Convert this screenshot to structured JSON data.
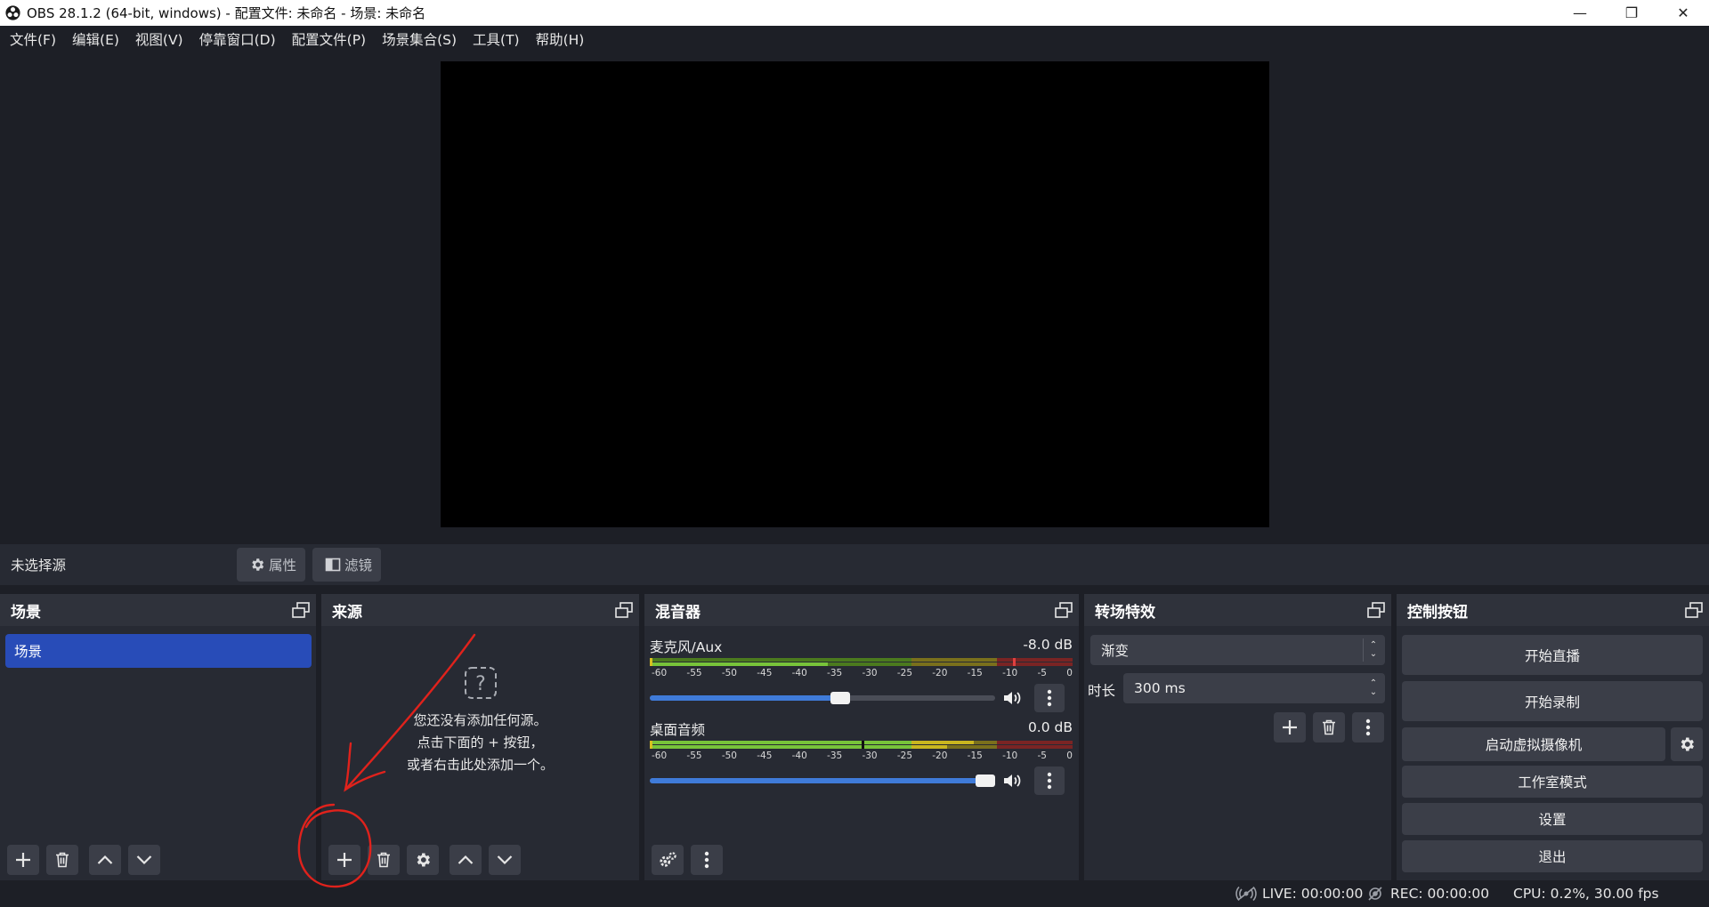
{
  "window": {
    "title": "OBS 28.1.2 (64-bit, windows) - 配置文件: 未命名 - 场景: 未命名",
    "minimize": "—",
    "restore": "❐",
    "close": "✕"
  },
  "menu": [
    "文件(F)",
    "编辑(E)",
    "视图(V)",
    "停靠窗口(D)",
    "配置文件(P)",
    "场景集合(S)",
    "工具(T)",
    "帮助(H)"
  ],
  "context": {
    "no_source": "未选择源",
    "properties": "属性",
    "filters": "滤镜"
  },
  "scenes": {
    "title": "场景",
    "items": [
      "场景"
    ]
  },
  "sources": {
    "title": "来源",
    "empty_lines": [
      "您还没有添加任何源。",
      "点击下面的 + 按钮，",
      "或者右击此处添加一个。"
    ]
  },
  "mixer": {
    "title": "混音器",
    "ticks": [
      "-60",
      "-55",
      "-50",
      "-45",
      "-40",
      "-35",
      "-30",
      "-25",
      "-20",
      "-15",
      "-10",
      "-5",
      "0"
    ],
    "channels": [
      {
        "name": "麦克风/Aux",
        "db": "-8.0 dB",
        "volume": 0.58
      },
      {
        "name": "桌面音频",
        "db": "0.0 dB",
        "volume": 1.0
      }
    ]
  },
  "transitions": {
    "title": "转场特效",
    "selected": "渐变",
    "duration_label": "时长",
    "duration_value": "300 ms"
  },
  "controls": {
    "title": "控制按钮",
    "start_stream": "开始直播",
    "start_record": "开始录制",
    "virtual_cam": "启动虚拟摄像机",
    "studio_mode": "工作室模式",
    "settings": "设置",
    "exit": "退出"
  },
  "status": {
    "live": "LIVE: 00:00:00",
    "rec": "REC: 00:00:00",
    "cpu": "CPU: 0.2%, 30.00 fps"
  },
  "colors": {
    "accent": "#284cb8",
    "annotation": "#e0221c"
  }
}
